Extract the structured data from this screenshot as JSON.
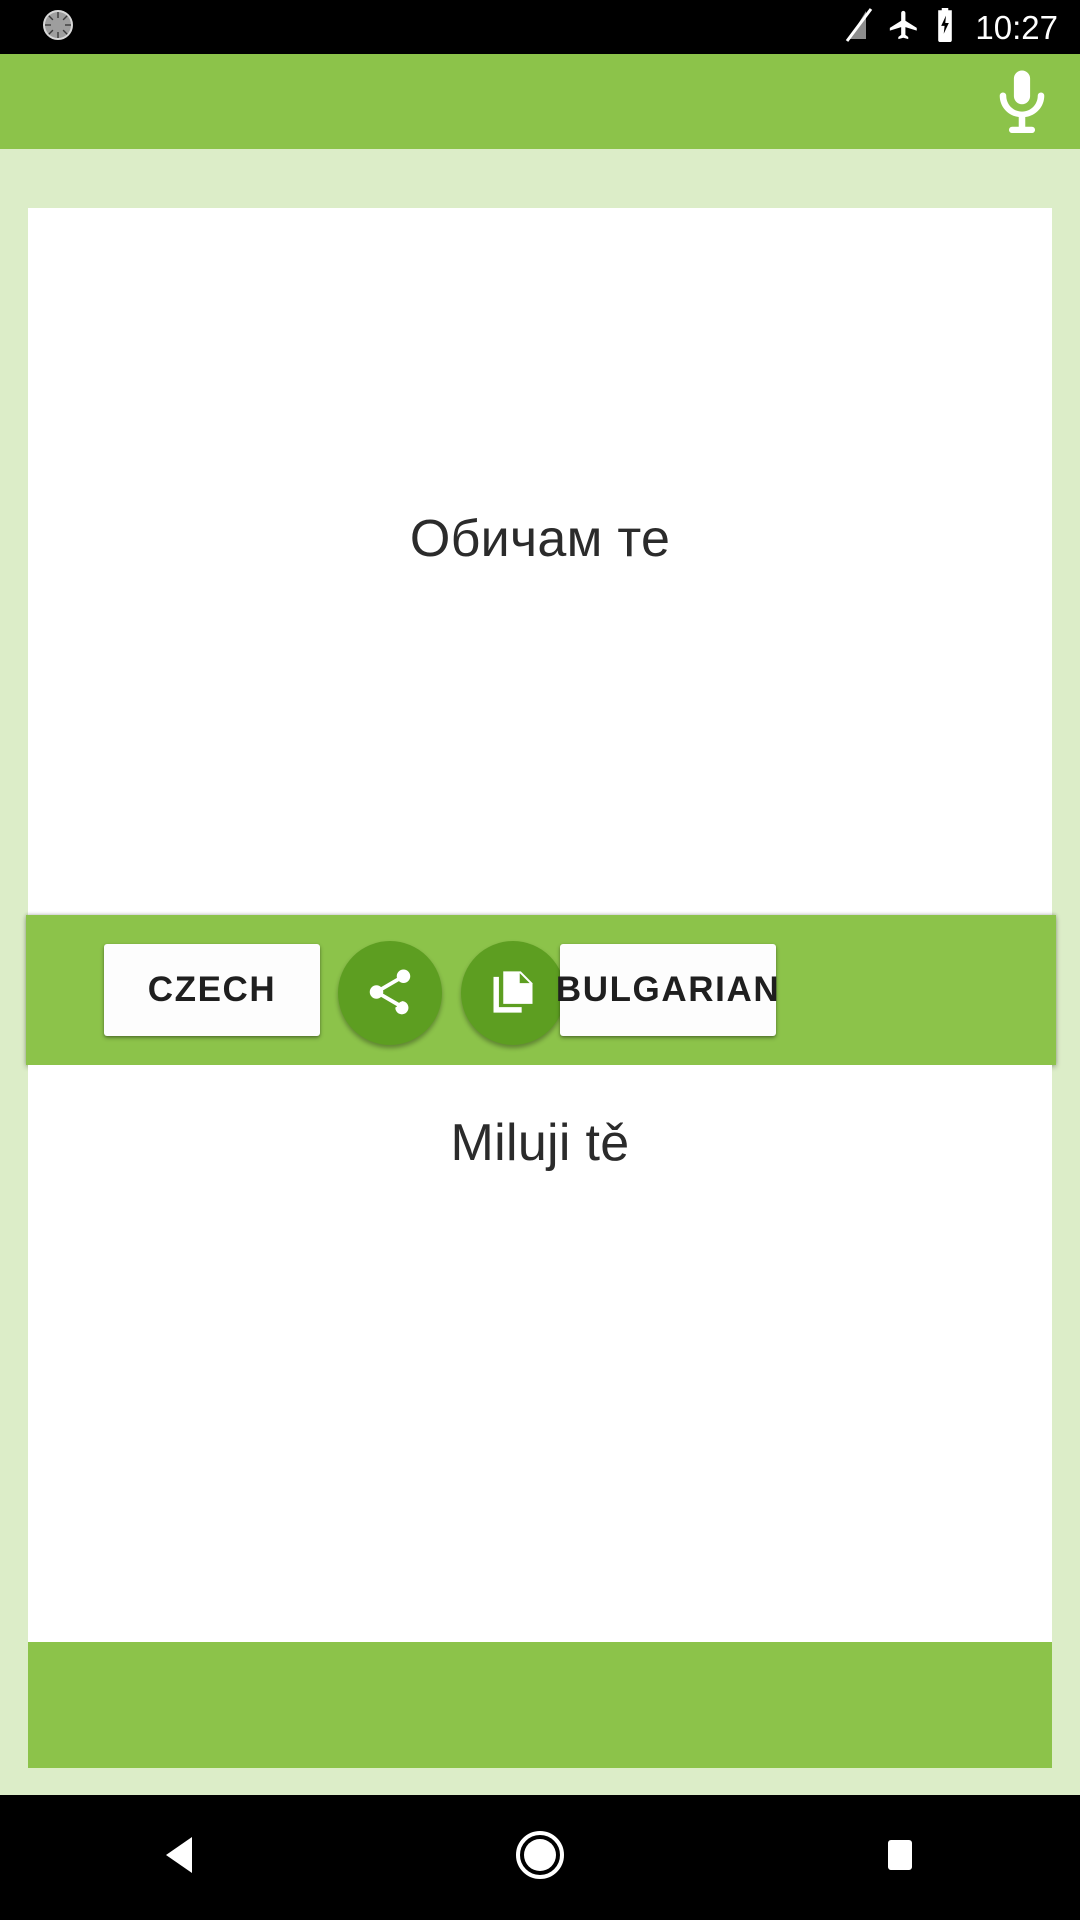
{
  "status_bar": {
    "time": "10:27",
    "icons": {
      "left_notification": "alarm-progress-icon",
      "signal_off": "signal-no-sim-icon",
      "airplane_mode": "airplane-mode-icon",
      "battery": "battery-charging-icon"
    },
    "background": "#000000",
    "foreground": "#FFFFFF"
  },
  "app_bar": {
    "background": "#8CC34A",
    "mic_icon": "microphone-icon",
    "title": ""
  },
  "translation": {
    "source": {
      "text": "Обичам те",
      "language_label": "BULGARIAN"
    },
    "target": {
      "text": "Miluji tě",
      "language_label": "CZECH"
    }
  },
  "action_bar": {
    "background": "#8CC34A",
    "left_language_button": "CZECH",
    "right_language_button": "BULGARIAN",
    "share_icon": "share-icon",
    "copy_icon": "copy-icon",
    "circle_color": "#5D9E21"
  },
  "bottom_band": {
    "background": "#8CC34A",
    "text": ""
  },
  "page": {
    "background": "#DCEDC8",
    "card_background": "#FFFFFF",
    "text_color": "#2B2B2B"
  },
  "nav_bar": {
    "background": "#000000",
    "back_icon": "back-triangle-icon",
    "home_icon": "home-circle-icon",
    "recents_icon": "recents-square-icon"
  }
}
